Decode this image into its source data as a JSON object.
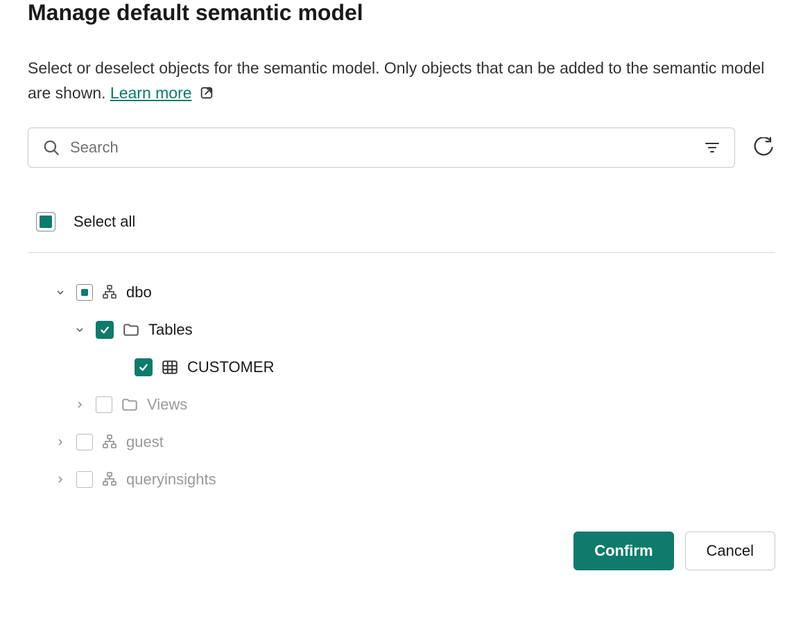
{
  "header": {
    "title": "Manage default semantic model",
    "description_prefix": "Select or deselect objects for the semantic model. Only objects that can be added to the semantic model are shown. ",
    "learn_more_label": "Learn more "
  },
  "search": {
    "placeholder": "Search"
  },
  "select_all": {
    "label": "Select all",
    "state": "indeterminate"
  },
  "tree": {
    "dbo": {
      "label": "dbo",
      "expanded": true,
      "state": "indeterminate",
      "tables": {
        "label": "Tables",
        "expanded": true,
        "state": "checked",
        "items": {
          "customer": {
            "label": "CUSTOMER",
            "state": "checked"
          }
        }
      },
      "views": {
        "label": "Views",
        "expanded": false,
        "state": "unchecked",
        "disabled": true
      }
    },
    "guest": {
      "label": "guest",
      "expanded": false,
      "state": "unchecked",
      "disabled": true
    },
    "queryinsights": {
      "label": "queryinsights",
      "expanded": false,
      "state": "unchecked",
      "disabled": true
    }
  },
  "footer": {
    "confirm_label": "Confirm",
    "cancel_label": "Cancel"
  },
  "colors": {
    "primary": "#0f7b6c"
  }
}
